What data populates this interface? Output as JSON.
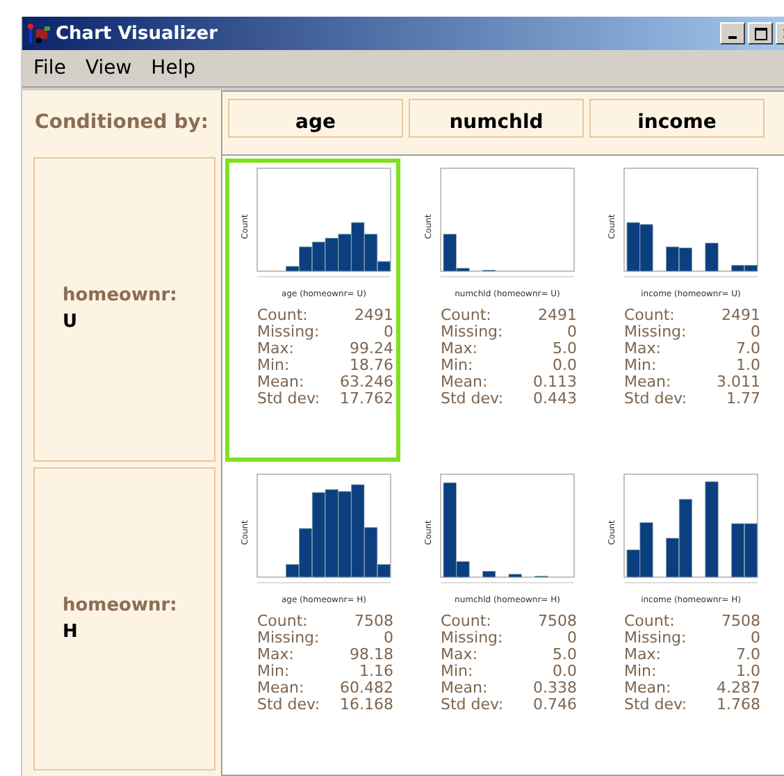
{
  "window": {
    "title": "Chart Visualizer"
  },
  "menu": [
    "File",
    "View",
    "Help"
  ],
  "conditioned_by": "Conditioned by:",
  "columns": [
    "age",
    "numchld",
    "income"
  ],
  "rows": [
    {
      "label": "homeownr:",
      "value": "U",
      "cells": [
        {
          "xlabel": "age (homeownr= U)",
          "ylabel": "Count",
          "selected": true,
          "stats": [
            {
              "name": "Count:",
              "value": "2491"
            },
            {
              "name": "Missing:",
              "value": "0"
            },
            {
              "name": "Max:",
              "value": "99.24"
            },
            {
              "name": "Min:",
              "value": "18.76"
            },
            {
              "name": "Mean:",
              "value": "63.246"
            },
            {
              "name": "Std dev:",
              "value": "17.762"
            }
          ]
        },
        {
          "xlabel": "numchld (homeownr= U)",
          "ylabel": "Count",
          "selected": false,
          "stats": [
            {
              "name": "Count:",
              "value": "2491"
            },
            {
              "name": "Missing:",
              "value": "0"
            },
            {
              "name": "Max:",
              "value": "5.0"
            },
            {
              "name": "Min:",
              "value": "0.0"
            },
            {
              "name": "Mean:",
              "value": "0.113"
            },
            {
              "name": "Std dev:",
              "value": "0.443"
            }
          ]
        },
        {
          "xlabel": "income (homeownr= U)",
          "ylabel": "Count",
          "selected": false,
          "stats": [
            {
              "name": "Count:",
              "value": "2491"
            },
            {
              "name": "Missing:",
              "value": "0"
            },
            {
              "name": "Max:",
              "value": "7.0"
            },
            {
              "name": "Min:",
              "value": "1.0"
            },
            {
              "name": "Mean:",
              "value": "3.011"
            },
            {
              "name": "Std dev:",
              "value": "1.77"
            }
          ]
        }
      ]
    },
    {
      "label": "homeownr:",
      "value": "H",
      "cells": [
        {
          "xlabel": "age (homeownr= H)",
          "ylabel": "Count",
          "selected": false,
          "stats": [
            {
              "name": "Count:",
              "value": "7508"
            },
            {
              "name": "Missing:",
              "value": "0"
            },
            {
              "name": "Max:",
              "value": "98.18"
            },
            {
              "name": "Min:",
              "value": "1.16"
            },
            {
              "name": "Mean:",
              "value": "60.482"
            },
            {
              "name": "Std dev:",
              "value": "16.168"
            }
          ]
        },
        {
          "xlabel": "numchld (homeownr= H)",
          "ylabel": "Count",
          "selected": false,
          "stats": [
            {
              "name": "Count:",
              "value": "7508"
            },
            {
              "name": "Missing:",
              "value": "0"
            },
            {
              "name": "Max:",
              "value": "5.0"
            },
            {
              "name": "Min:",
              "value": "0.0"
            },
            {
              "name": "Mean:",
              "value": "0.338"
            },
            {
              "name": "Std dev:",
              "value": "0.746"
            }
          ]
        },
        {
          "xlabel": "income (homeownr= H)",
          "ylabel": "Count",
          "selected": false,
          "stats": [
            {
              "name": "Count:",
              "value": "7508"
            },
            {
              "name": "Missing:",
              "value": "0"
            },
            {
              "name": "Max:",
              "value": "7.0"
            },
            {
              "name": "Min:",
              "value": "1.0"
            },
            {
              "name": "Mean:",
              "value": "4.287"
            },
            {
              "name": "Std dev:",
              "value": "1.768"
            }
          ]
        }
      ]
    }
  ]
}
